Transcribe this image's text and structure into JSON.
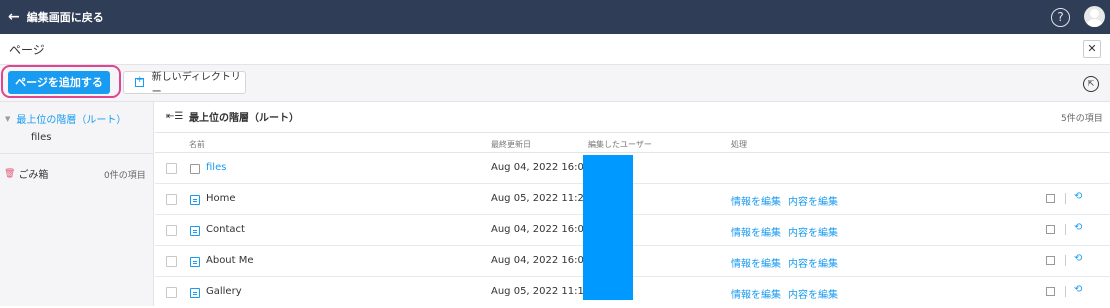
{
  "topbar": {
    "back_label": "編集画面に戻る",
    "help_glyph": "?"
  },
  "page": {
    "title": "ページ",
    "close_glyph": "✕"
  },
  "toolbar": {
    "add_page_label": "ページを追加する",
    "new_directory_label": "新しいディレクトリー",
    "export_glyph": "⇱"
  },
  "sidebar": {
    "root_label": "最上位の階層（ルート）",
    "child_label": "files",
    "trash_label": "ごみ箱",
    "trash_count": "0件の項目"
  },
  "main": {
    "hierarchy_label": "最上位の階層（ルート）",
    "item_count": "5件の項目",
    "columns": {
      "name": "名前",
      "updated": "最終更新日",
      "user": "編集したユーザー",
      "actions": "処理"
    },
    "rows": [
      {
        "name": "files",
        "type": "folder",
        "date": "Aug 04, 2022 16:03"
      },
      {
        "name": "Home",
        "type": "page",
        "date": "Aug 05, 2022 11:20",
        "edit_info": "情報を編集",
        "edit_content": "内容を編集"
      },
      {
        "name": "Contact",
        "type": "page",
        "date": "Aug 04, 2022 16:03",
        "edit_info": "情報を編集",
        "edit_content": "内容を編集"
      },
      {
        "name": "About Me",
        "type": "page",
        "date": "Aug 04, 2022 16:03",
        "edit_info": "情報を編集",
        "edit_content": "内容を編集"
      },
      {
        "name": "Gallery",
        "type": "page",
        "date": "Aug 05, 2022 11:19",
        "edit_info": "情報を編集",
        "edit_content": "内容を編集"
      }
    ]
  },
  "colors": {
    "topbar": "#2f3e56",
    "accent": "#189bf0",
    "highlight": "#e0468f",
    "redaction": "#0099ff"
  }
}
